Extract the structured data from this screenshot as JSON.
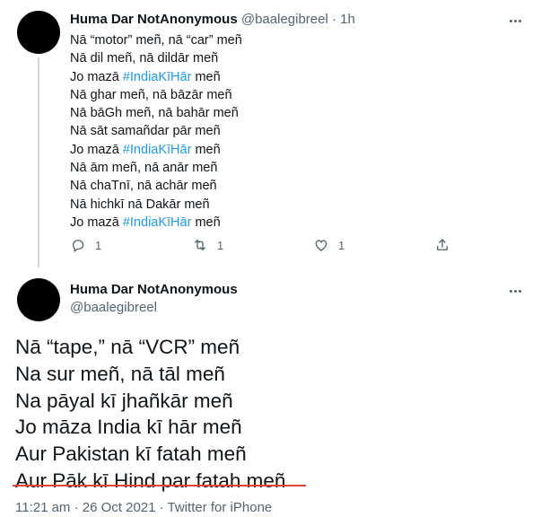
{
  "tweet1": {
    "author_name": "Huma Dar NotAnonymous",
    "handle": "@baalegibreel",
    "separator": "·",
    "time": "1h",
    "lines": [
      [
        "Nā “motor” meñ, nā “car” meñ"
      ],
      [
        "Nā dil meñ, nā dildār meñ"
      ],
      [
        "Jo mazā ",
        "#IndiaKīHār",
        " meñ"
      ],
      [
        "Nā ghar meñ, nā bāzār meñ"
      ],
      [
        "Nā bāGh meñ, nā bahār meñ"
      ],
      [
        "Nā sāt samañdar pār meñ"
      ],
      [
        "Jo mazā ",
        "#IndiaKīHār",
        " meñ"
      ],
      [
        "Nā ām meñ, nā anār meñ"
      ],
      [
        "Nā chaTnī, nā achār meñ"
      ],
      [
        "Nā hichkī nā Dakār meñ"
      ],
      [
        "Jo mazā ",
        "#IndiaKīHār",
        " meñ"
      ]
    ],
    "actions": {
      "reply_count": "1",
      "retweet_count": "1",
      "like_count": "1"
    }
  },
  "tweet2": {
    "author_name": "Huma Dar NotAnonymous",
    "handle": "@baalegibreel",
    "lines": [
      "Nā “tape,” nā “VCR” meñ",
      "Na sur meñ, nā tāl meñ",
      "Na pāyal kī jhañkār meñ",
      "Jo māza India kī hār meñ",
      "Aur Pakistan kī fatah meñ",
      "Aur Pāk kī Hind par fatah meñ"
    ],
    "meta": "11:21 am · 26 Oct 2021 · Twitter for iPhone"
  },
  "colors": {
    "link": "#1d9bf0",
    "muted": "#536471",
    "annotation_underline": "#e0453b"
  }
}
